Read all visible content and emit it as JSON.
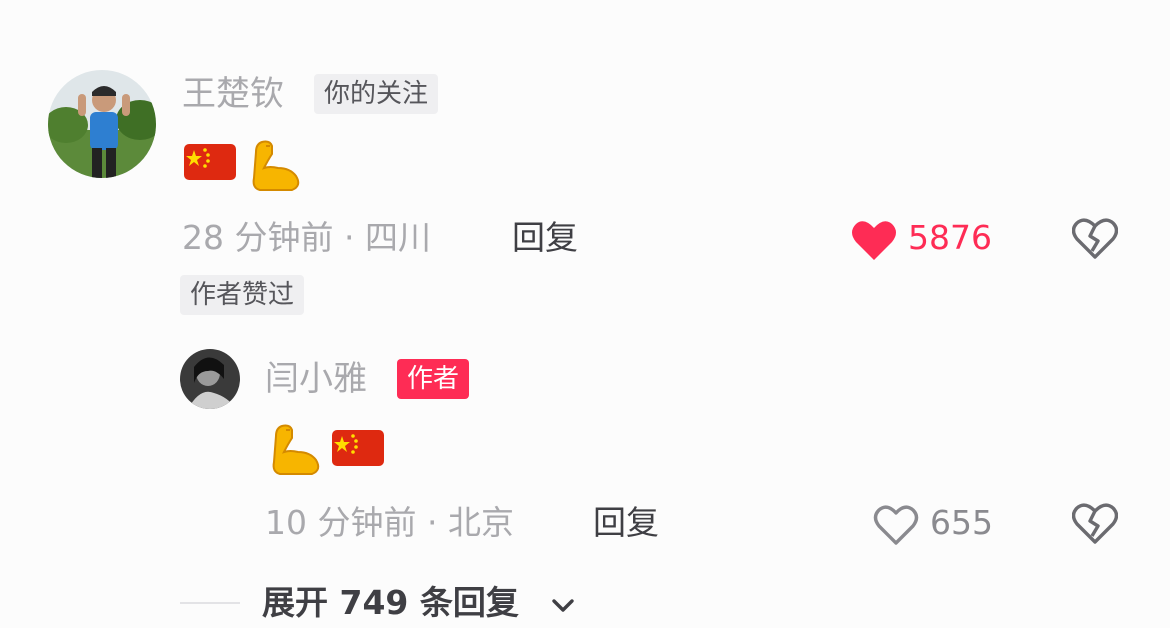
{
  "comment": {
    "author_name": "王楚钦",
    "author_badge": "你的关注",
    "emojis": [
      "flag-china",
      "flexed-biceps"
    ],
    "time_location": "28 分钟前 · 四川",
    "reply_label": "回复",
    "like_count": "5876",
    "liked": true,
    "liked_by_author_badge": "作者赞过"
  },
  "reply": {
    "author_name": "闫小雅",
    "author_badge": "作者",
    "emojis": [
      "flexed-biceps",
      "flag-china"
    ],
    "time_location": "10 分钟前 · 北京",
    "reply_label": "回复",
    "like_count": "655",
    "liked": false
  },
  "expand_replies_label": "展开 749 条回复",
  "colors": {
    "accent_red": "#fe2c55",
    "muted_text": "#a9a9ad",
    "primary_text": "#3f3f44",
    "badge_bg": "#efeff1"
  }
}
